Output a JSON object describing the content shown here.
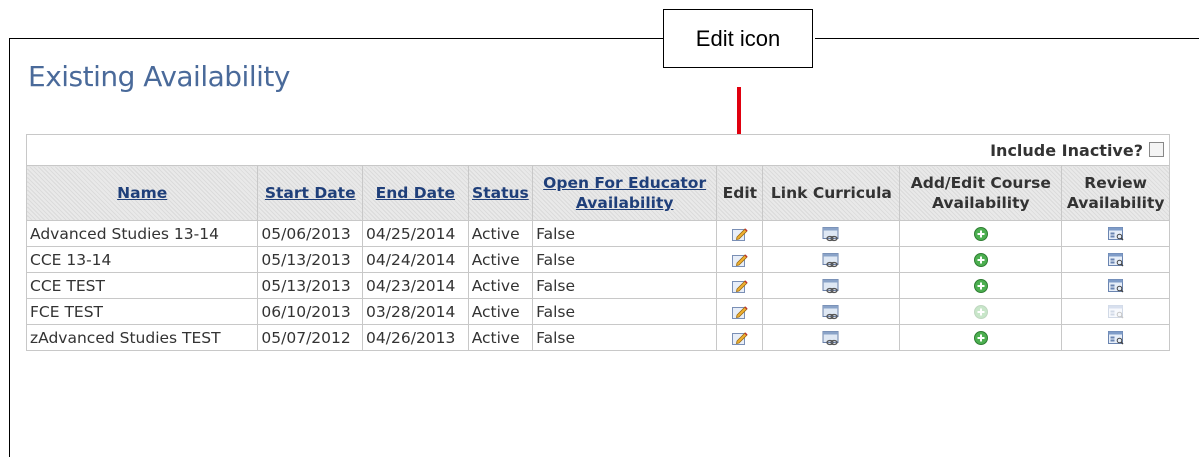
{
  "annotation": {
    "callout_text": "Edit icon"
  },
  "page": {
    "title": "Existing Availability"
  },
  "table": {
    "include_inactive_label": "Include Inactive?",
    "include_inactive_checked": false,
    "headers": {
      "name": "Name",
      "start_date": "Start Date",
      "end_date": "End Date",
      "status": "Status",
      "open_for_educator": "Open For Educator Availability",
      "edit": "Edit",
      "link_curricula": "Link Curricula",
      "add_edit_course": "Add/Edit Course Availability",
      "review": "Review Availability"
    },
    "rows": [
      {
        "name": "Advanced Studies 13-14",
        "start_date": "05/06/2013",
        "end_date": "04/25/2014",
        "status": "Active",
        "open": "False",
        "icons_enabled": true
      },
      {
        "name": "CCE 13-14",
        "start_date": "05/13/2013",
        "end_date": "04/24/2014",
        "status": "Active",
        "open": "False",
        "icons_enabled": true
      },
      {
        "name": "CCE TEST",
        "start_date": "05/13/2013",
        "end_date": "04/23/2014",
        "status": "Active",
        "open": "False",
        "icons_enabled": true
      },
      {
        "name": "FCE TEST",
        "start_date": "06/10/2013",
        "end_date": "03/28/2014",
        "status": "Active",
        "open": "False",
        "icons_enabled": false
      },
      {
        "name": "zAdvanced Studies TEST",
        "start_date": "05/07/2012",
        "end_date": "04/26/2013",
        "status": "Active",
        "open": "False",
        "icons_enabled": true
      }
    ],
    "icons": {
      "edit": "pencil-edit-icon",
      "link_curricula": "link-curricula-icon",
      "add_edit_course": "add-plus-circle-icon",
      "review": "review-list-icon"
    }
  },
  "colors": {
    "title": "#4a6a9a",
    "header_link": "#1f3f7a",
    "arrow": "#e0000f",
    "add_green": "#4caf50"
  }
}
